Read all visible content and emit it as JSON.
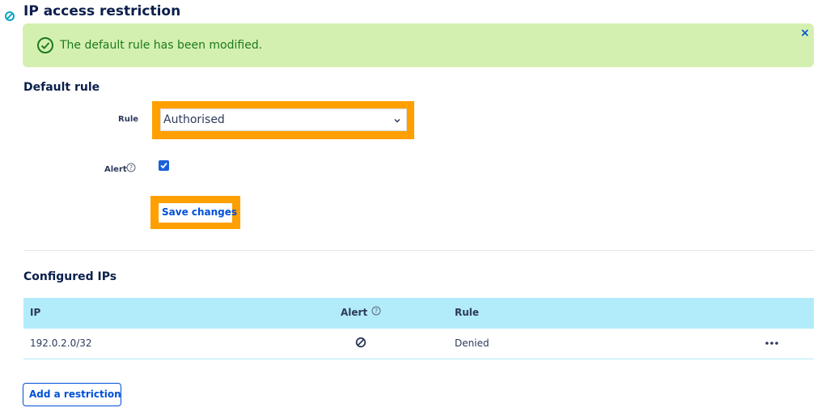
{
  "page": {
    "title": "IP access restriction"
  },
  "notification": {
    "message": "The default rule has been modified.",
    "close_symbol": "×"
  },
  "default_rule": {
    "section_title": "Default rule",
    "rule_label": "Rule",
    "rule_value": "Authorised",
    "alert_label": "Alert",
    "alert_checked": true,
    "save_label": "Save changes"
  },
  "configured_ips": {
    "section_title": "Configured IPs",
    "columns": {
      "ip": "IP",
      "alert": "Alert",
      "rule": "Rule"
    },
    "rows": [
      {
        "ip": "192.0.2.0/32",
        "alert_icon": "disabled-icon",
        "rule": "Denied",
        "menu_icon": "more-options-icon"
      }
    ],
    "add_label": "Add a restriction"
  },
  "colors": {
    "accent": "#0050d7",
    "success_bg": "#d4f0b0",
    "success_text": "#1c7a1c",
    "table_header_bg": "#b2ecfb",
    "highlight": "#ff9f00"
  }
}
